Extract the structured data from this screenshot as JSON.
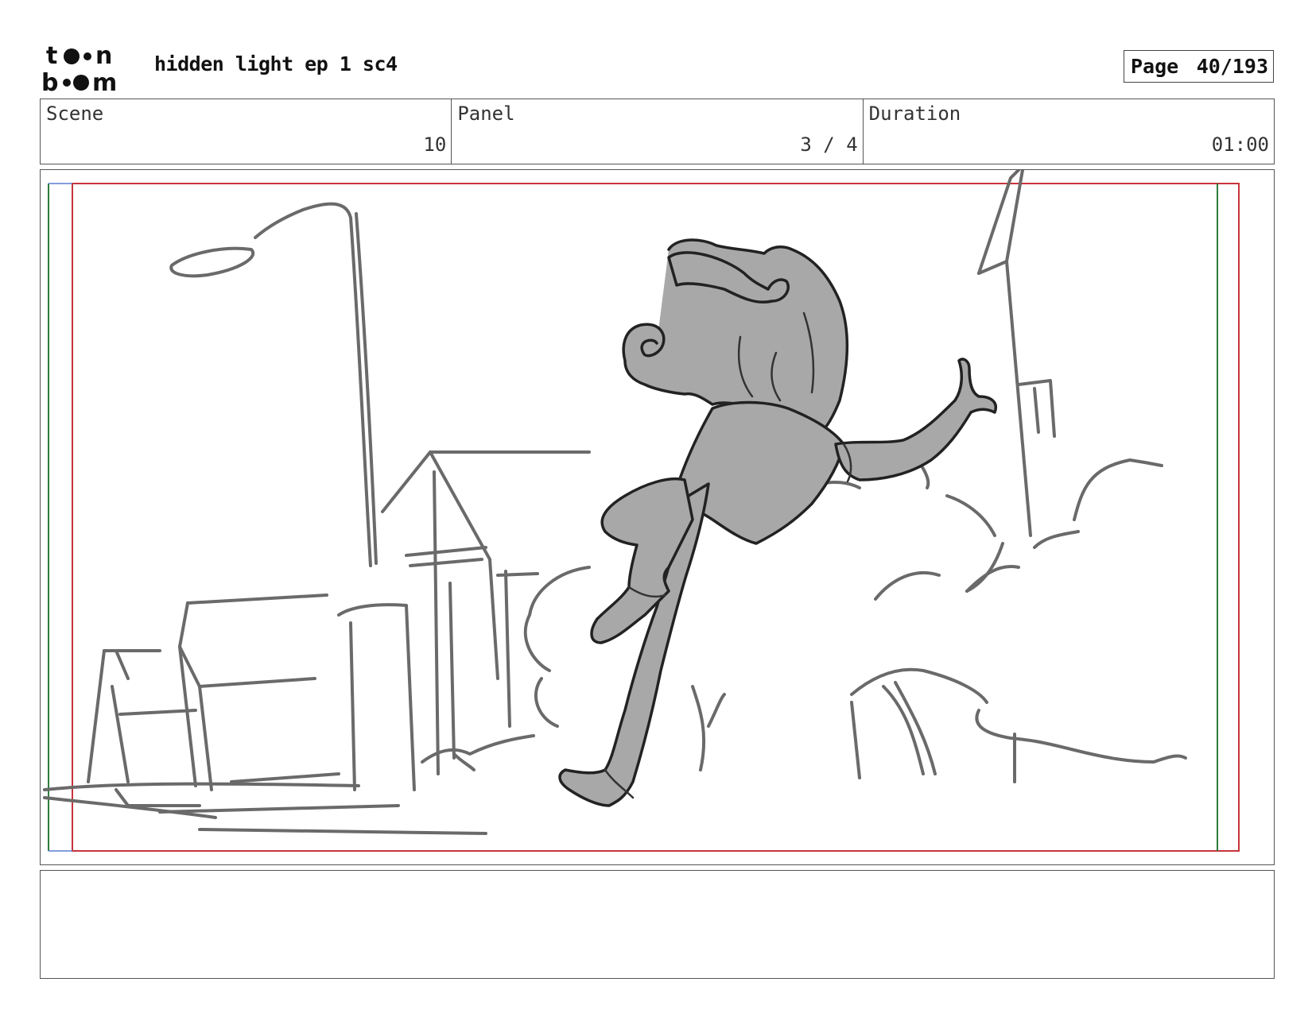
{
  "header": {
    "logo_text": "toon boom",
    "title": "hidden light ep 1 sc4",
    "page_label": "Page",
    "page_value": "40/193"
  },
  "info": {
    "scene_label": "Scene",
    "scene_value": "10",
    "panel_label": "Panel",
    "panel_value": "3 / 4",
    "duration_label": "Duration",
    "duration_value": "01:00"
  },
  "notes": {
    "text": ""
  },
  "colors": {
    "safe_frame": "#c8343c",
    "action_safe": "#2e7d3a",
    "character_fill": "#a8a8a8",
    "sketch_line": "#6a6a6a"
  }
}
